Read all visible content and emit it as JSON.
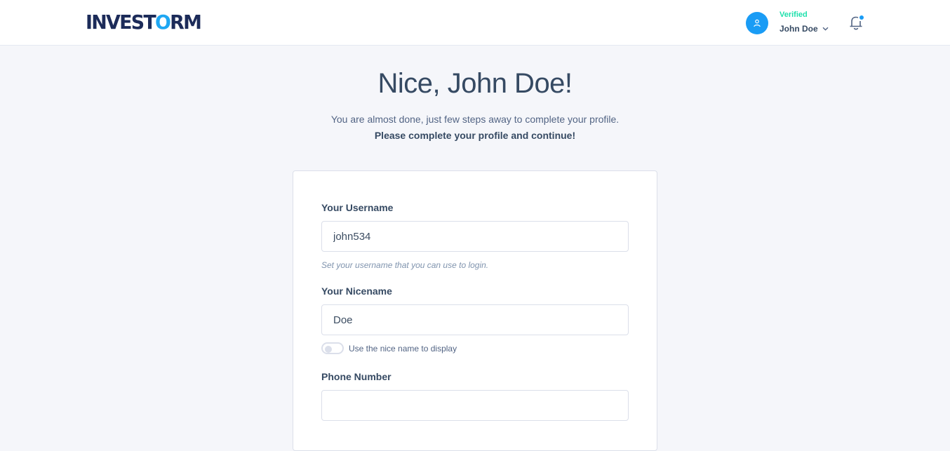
{
  "header": {
    "logo_part1": "INVEST",
    "logo_accent": "O",
    "logo_part2": "RM",
    "user": {
      "status": "Verified",
      "name": "John Doe",
      "avatar_icon": "user-icon",
      "dropdown_icon": "chevron-down-icon"
    },
    "notification_icon": "bell-icon",
    "notification_has_unread": true
  },
  "hero": {
    "title": "Nice, John Doe!",
    "subtitle": "You are almost done, just few steps away to complete your profile.",
    "subtitle_strong": "Please complete your profile and continue!"
  },
  "form": {
    "username": {
      "label": "Your Username",
      "value": "john534",
      "placeholder": "",
      "hint": "Set your username that you can use to login."
    },
    "nicename": {
      "label": "Your Nicename",
      "value": "Doe",
      "placeholder": ""
    },
    "use_nicename_toggle": {
      "label": "Use the nice name to display",
      "checked": false
    },
    "phone": {
      "label": "Phone Number",
      "value": "",
      "placeholder": ""
    }
  },
  "colors": {
    "brand_dark": "#1c2b59",
    "brand_accent": "#1ea7f3",
    "verified": "#1ee0ac",
    "avatar_bg": "#1a9cf5",
    "page_bg": "#f5f6fa"
  }
}
